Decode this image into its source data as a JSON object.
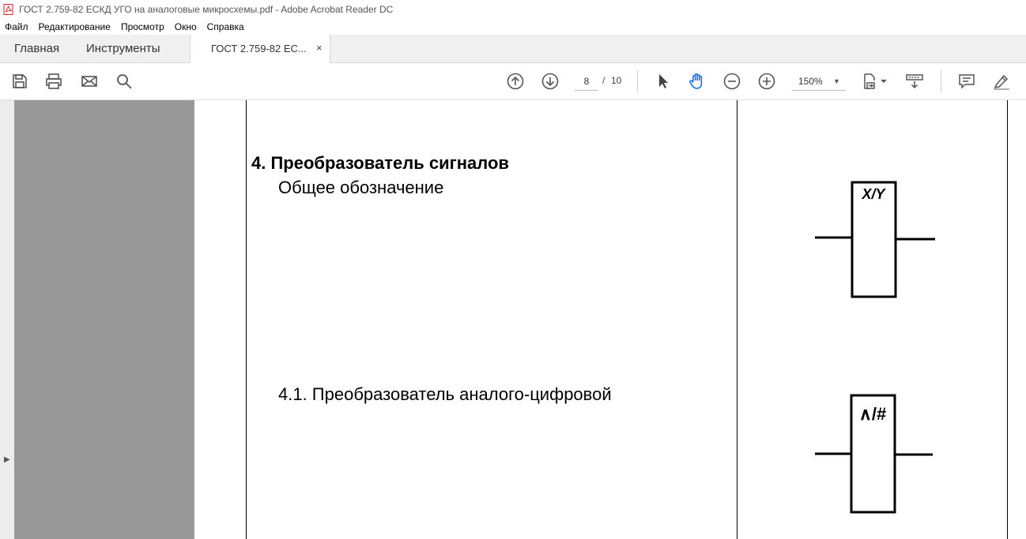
{
  "window": {
    "title": "ГОСТ 2.759-82 ЕСКД УГО на аналоговые микросхемы.pdf - Adobe Acrobat Reader DC"
  },
  "menu": [
    "Файл",
    "Редактирование",
    "Просмотр",
    "Окно",
    "Справка"
  ],
  "tabs": {
    "home": "Главная",
    "tools": "Инструменты",
    "document": "ГОСТ 2.759-82 ЕС...",
    "close": "×"
  },
  "toolbar": {
    "page_current": "8",
    "page_separator": "/",
    "page_total": "10",
    "zoom": "150%",
    "icons": [
      "save-icon",
      "print-icon",
      "email-icon",
      "search-icon",
      "arrow-up-icon",
      "arrow-down-icon",
      "select-pointer-icon",
      "hand-icon",
      "zoom-out-icon",
      "zoom-in-icon",
      "page-fit-icon",
      "scroll-mode-icon",
      "comment-icon",
      "highlight-pen-icon"
    ]
  },
  "document": {
    "heading": "4. Преобразователь сигналов",
    "subheading_general": "Общее обозначение",
    "subheading_adc": "4.1. Преобразователь аналого-цифровой",
    "symbol_general_label": "X/Y",
    "symbol_adc_label": "∧/#"
  },
  "colors": {
    "gray_panel": "#999999",
    "hand_tool_active": "#1473e6"
  }
}
